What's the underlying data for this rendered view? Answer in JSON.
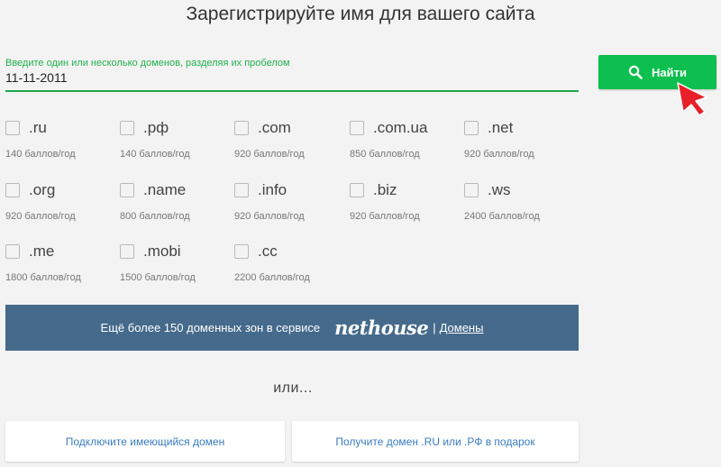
{
  "title": "Зарегистрируйте имя для вашего сайта",
  "domain_input": {
    "label": "Введите один или несколько доменов, разделяя их пробелом",
    "value": "11-11-2011"
  },
  "search_button": {
    "label": "Найти",
    "icon": "search-icon"
  },
  "zones": [
    {
      "name": ".ru",
      "price": "140 баллов/год",
      "checked": false
    },
    {
      "name": ".рф",
      "price": "140 баллов/год",
      "checked": false
    },
    {
      "name": ".com",
      "price": "920 баллов/год",
      "checked": false
    },
    {
      "name": ".com.ua",
      "price": "850 баллов/год",
      "checked": false
    },
    {
      "name": ".net",
      "price": "920 баллов/год",
      "checked": false
    },
    {
      "name": ".org",
      "price": "920 баллов/год",
      "checked": false
    },
    {
      "name": ".name",
      "price": "800 баллов/год",
      "checked": false
    },
    {
      "name": ".info",
      "price": "920 баллов/год",
      "checked": false
    },
    {
      "name": ".biz",
      "price": "920 баллов/год",
      "checked": false
    },
    {
      "name": ".ws",
      "price": "2400 баллов/год",
      "checked": false
    },
    {
      "name": ".me",
      "price": "1800 баллов/год",
      "checked": false
    },
    {
      "name": ".mobi",
      "price": "1500 баллов/год",
      "checked": false
    },
    {
      "name": ".cc",
      "price": "2200 баллов/год",
      "checked": false
    }
  ],
  "banner": {
    "text": "Ещё более 150 доменных зон в сервисе",
    "logo": "nethouse",
    "separator": "|",
    "link": "Домены"
  },
  "or_text": "или...",
  "buttons": {
    "connect": "Подключите имеющийся домен",
    "gift": "Получите домен .RU или .РФ в подарок"
  },
  "colors": {
    "accent_green": "#0cbf4e",
    "banner_blue": "#456a8b",
    "link_blue": "#3a7bc0",
    "cursor_red": "#e8202a"
  }
}
